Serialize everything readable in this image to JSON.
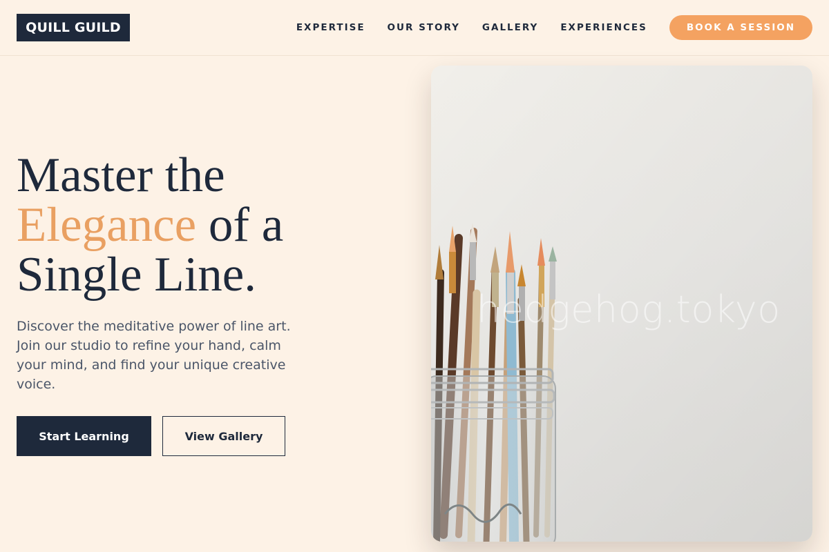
{
  "brand": {
    "name": "QUILL GUILD"
  },
  "nav": {
    "items": [
      "EXPERTISE",
      "OUR STORY",
      "GALLERY",
      "EXPERIENCES"
    ],
    "cta": "BOOK A SESSION"
  },
  "hero": {
    "headline": {
      "line1": "Master the",
      "accent": "Elegance",
      "line2_rest": " of a",
      "line3": "Single Line."
    },
    "description": "Discover the meditative power of line art. Join our studio to refine your hand, calm your mind, and find your unique creative voice.",
    "primary_button": "Start Learning",
    "secondary_button": "View Gallery",
    "image_watermark": "hedgehog.tokyo"
  },
  "colors": {
    "navy": "#1e293b",
    "accent": "#f4a261",
    "background": "#fdf2e6"
  }
}
